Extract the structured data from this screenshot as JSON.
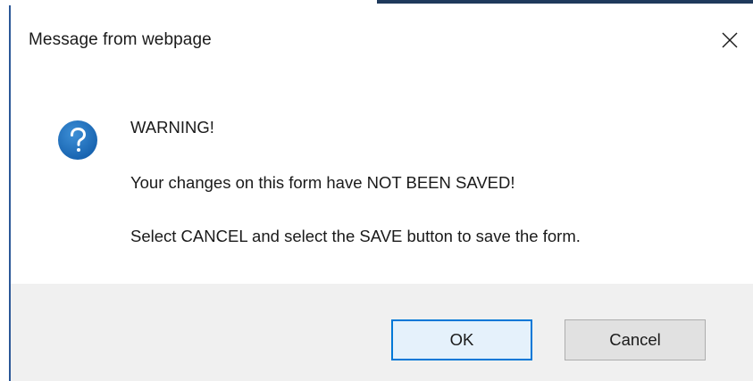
{
  "dialog": {
    "title": "Message from webpage",
    "close_icon": "close-icon",
    "icon": "question-icon",
    "accent_color": "#1e73be",
    "message": {
      "heading": "WARNING!",
      "line_1": "Your changes on this form have NOT BEEN SAVED!",
      "line_2": "Select CANCEL and select the SAVE button to save the form."
    },
    "buttons": {
      "ok_label": "OK",
      "cancel_label": "Cancel"
    }
  }
}
